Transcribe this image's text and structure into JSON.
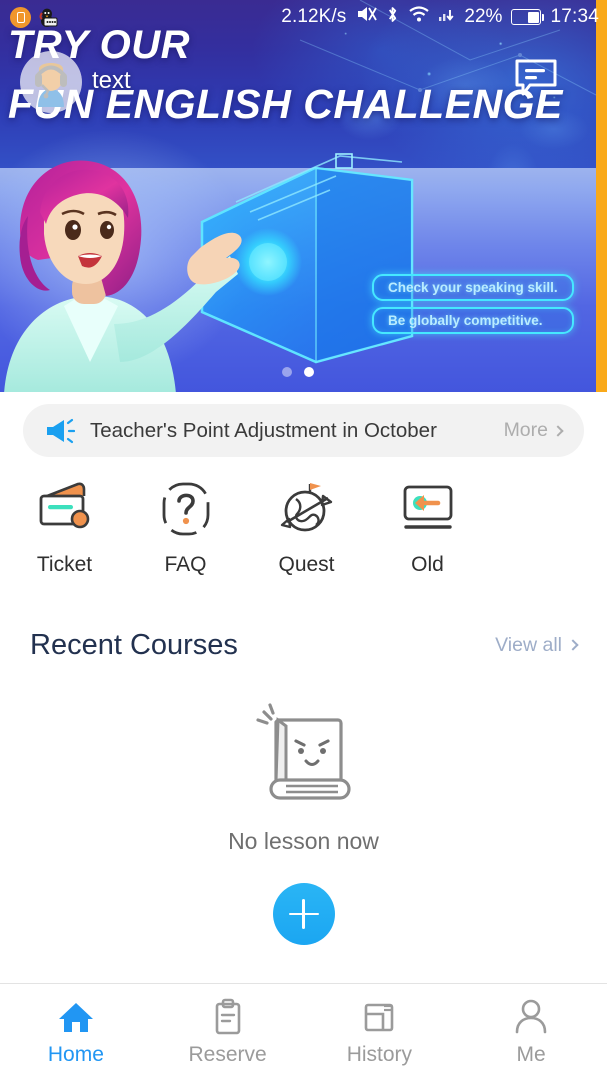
{
  "status_bar": {
    "left_icons": [
      "app-badge-icon",
      "penguin-icon"
    ],
    "network_speed": "2.12K/s",
    "right_icons": [
      "mute-icon",
      "bluetooth-icon",
      "wifi-icon",
      "signal-icon"
    ],
    "battery_percent": "22%",
    "time": "17:34"
  },
  "banner": {
    "headline_line1": "TRY OUR",
    "headline_line2": "FUN ENGLISH CHALLENGE",
    "agent_label": "text",
    "agent_icon": "support-agent-avatar",
    "message_icon": "message-bubble-icon",
    "tags": [
      "Check your speaking skill.",
      "Be globally competitive."
    ],
    "dots": 2,
    "active_dot": 1,
    "peek_color": "#f9a91a"
  },
  "announcement": {
    "icon": "megaphone-icon",
    "text": "Teacher's Point Adjustment in October",
    "more_label": "More",
    "chevron": "chevron-right-icon"
  },
  "quick_actions": [
    {
      "label": "Ticket",
      "icon": "wallet-ticket-icon"
    },
    {
      "label": "FAQ",
      "icon": "question-mark-icon"
    },
    {
      "label": "Quest",
      "icon": "globe-flag-icon"
    },
    {
      "label": "Old",
      "icon": "monitor-arrow-icon"
    }
  ],
  "recent_courses": {
    "title": "Recent Courses",
    "view_all_label": "View all",
    "empty_icon": "book-face-icon",
    "empty_text": "No lesson now",
    "add_button_icon": "plus-icon",
    "add_button_color": "#1ea7f0"
  },
  "bottom_nav": {
    "active_color": "#2196f3",
    "inactive_color": "#9b9b9b",
    "items": [
      {
        "label": "Home",
        "icon": "home-icon",
        "active": true
      },
      {
        "label": "Reserve",
        "icon": "clipboard-icon",
        "active": false
      },
      {
        "label": "History",
        "icon": "book-icon",
        "active": false
      },
      {
        "label": "Me",
        "icon": "person-icon",
        "active": false
      }
    ]
  }
}
